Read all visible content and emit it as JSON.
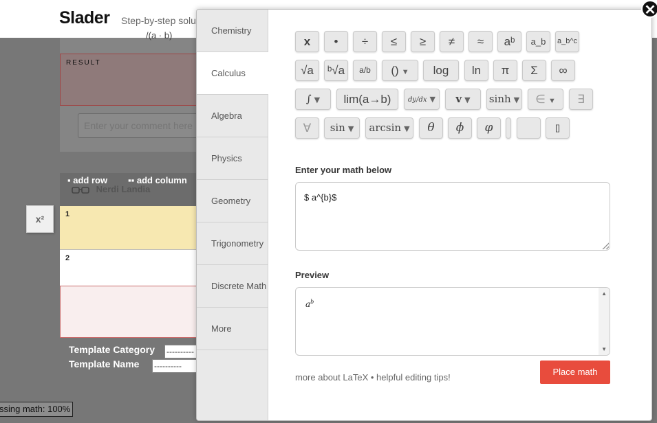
{
  "header": {
    "logo": "Slader",
    "tagline": "Step-by-step solu"
  },
  "background": {
    "fraction_fragment": "/(a · b)",
    "result_label": "RESULT",
    "comment_placeholder": "Enter your comment here",
    "add_row": "add row",
    "add_column": "add column",
    "user_name": "Nerdi Landia",
    "rows": [
      "1",
      "2"
    ],
    "x2_button": "x²",
    "template_category_label": "Template Category",
    "template_name_label": "Template Name",
    "template_category_value": "----------",
    "template_name_value": "----------",
    "processing": "ssing math: 100%"
  },
  "modal": {
    "tabs": [
      {
        "label": "Chemistry"
      },
      {
        "label": "Calculus"
      },
      {
        "label": "Algebra"
      },
      {
        "label": "Physics"
      },
      {
        "label": "Geometry"
      },
      {
        "label": "Trigonometry"
      },
      {
        "label": "Discrete Math"
      },
      {
        "label": "More"
      }
    ],
    "active_tab": "Calculus",
    "symbols_row1": [
      "x",
      "•",
      "÷",
      "≤",
      "≥",
      "≠",
      "≈",
      "aᵇ",
      "a_b",
      "a_b^c"
    ],
    "symbols_row2": [
      "√a",
      "ᵇ√a",
      "a/b",
      "()",
      "log",
      "ln",
      "π",
      "Σ",
      "∞"
    ],
    "symbols_row3": [
      "∫",
      "lim(a→b)",
      "dy/dx",
      "v",
      "sinh",
      "∈",
      "∃"
    ],
    "symbols_row4": [
      "∀",
      "sin",
      "arcsin",
      "θ",
      "ϕ",
      "φ",
      "[]"
    ],
    "enter_label": "Enter your math below",
    "input_value": "$ a^{b}$",
    "preview_label": "Preview",
    "preview_base": "a",
    "preview_sup": "b",
    "links_text": "more about LaTeX • helpful editing tips!",
    "place_button": "Place math",
    "close_symbol": "✕"
  },
  "colors": {
    "accent": "#e84c3d",
    "row_highlight": "#f7e8b1"
  }
}
